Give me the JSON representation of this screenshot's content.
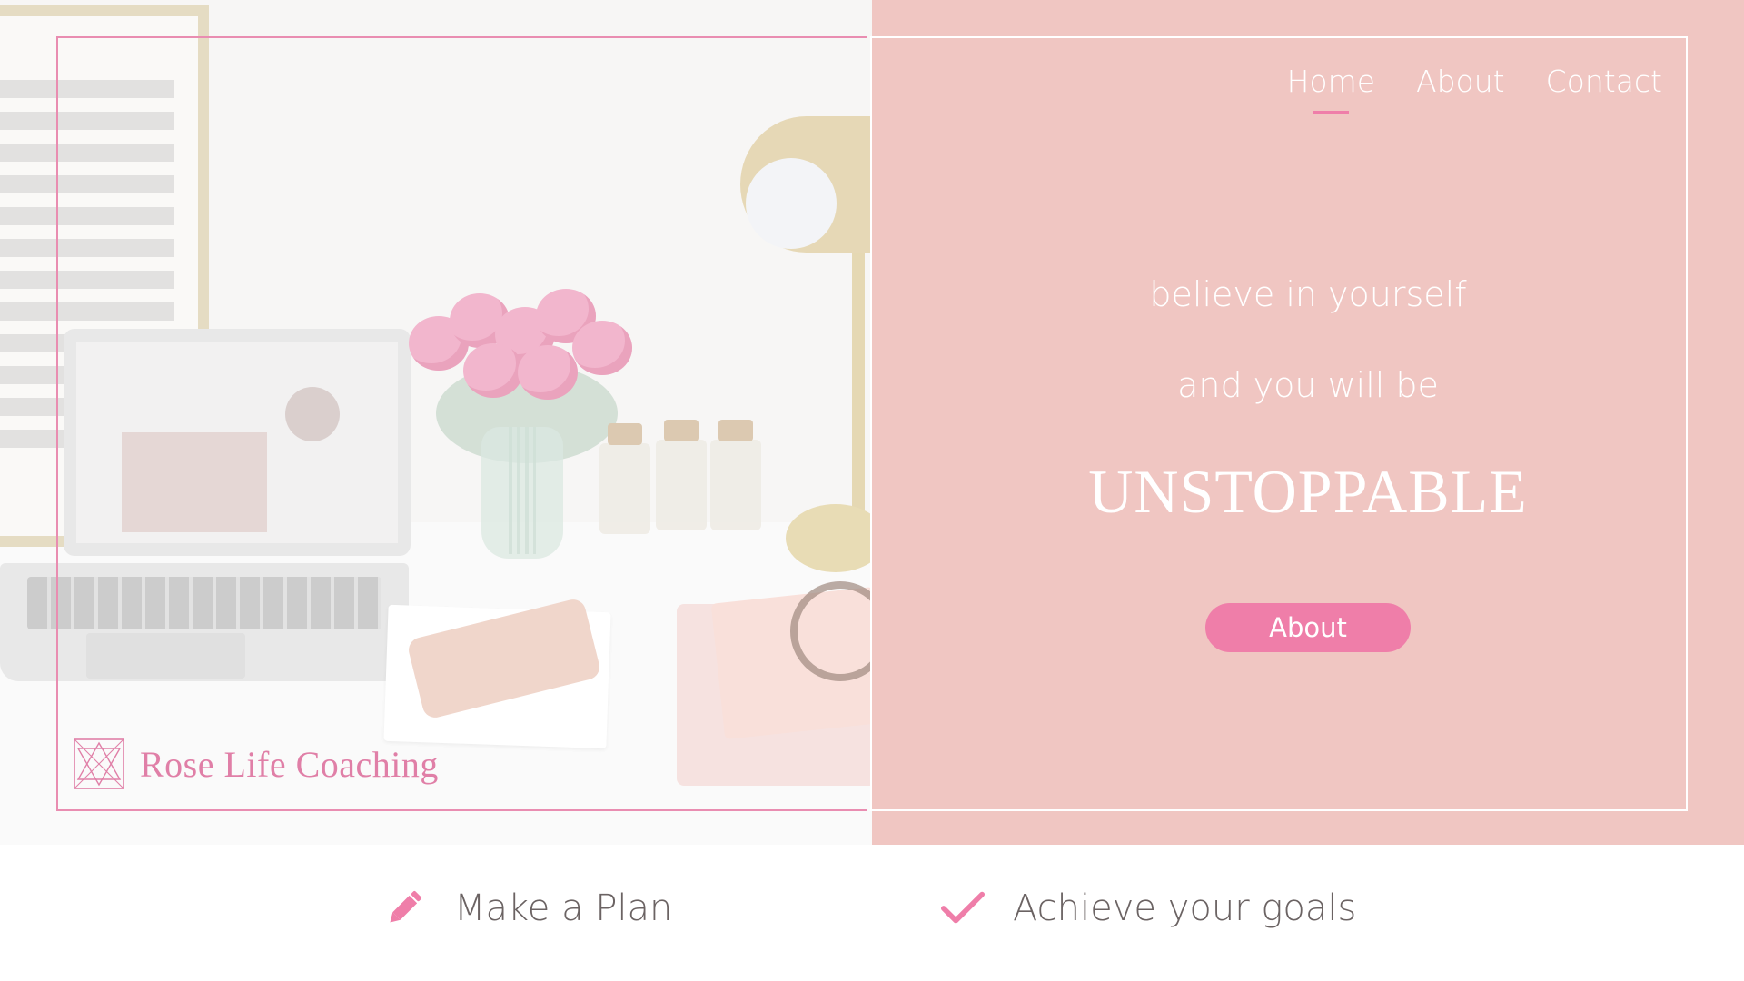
{
  "brand": {
    "name": "Rose Life Coaching",
    "accent_color": "#ef7ea9",
    "panel_color": "#f0c6c2"
  },
  "nav": {
    "items": [
      {
        "label": "Home",
        "active": true
      },
      {
        "label": "About",
        "active": false
      },
      {
        "label": "Contact",
        "active": false
      }
    ]
  },
  "hero": {
    "line1": "believe in yourself",
    "line2": "and you will be",
    "headline": "UNSTOPPABLE",
    "button_label": "About",
    "photo_icon": "desk-workspace-photo"
  },
  "features": [
    {
      "label": "Make a Plan",
      "icon": "pencil-icon"
    },
    {
      "label": "Achieve your goals",
      "icon": "checkmark-icon"
    }
  ]
}
